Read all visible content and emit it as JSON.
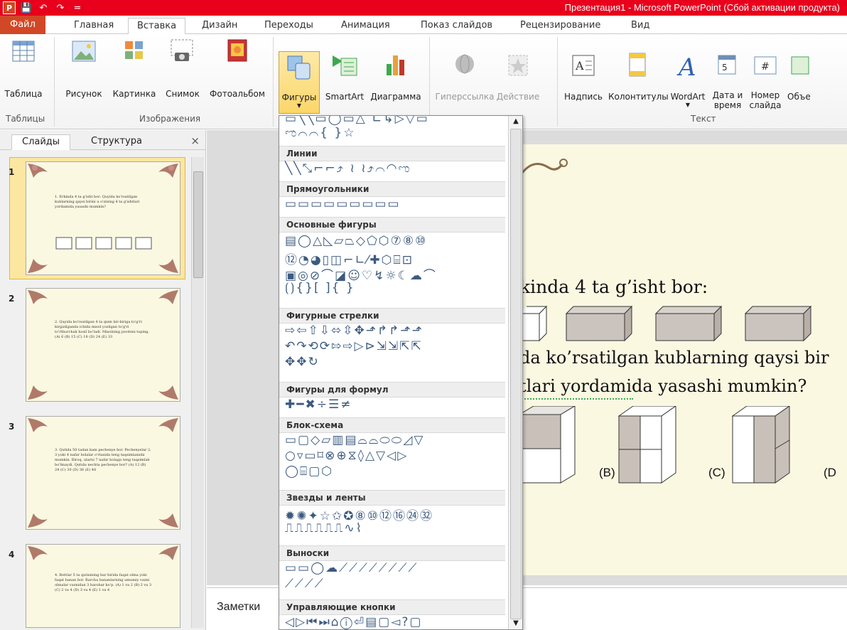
{
  "window": {
    "title": "Презентация1 - Microsoft PowerPoint (Сбой активации продукта)"
  },
  "quick_access": [
    "P",
    "💾",
    "↶",
    "↷",
    "="
  ],
  "tabs": [
    {
      "label": "Файл"
    },
    {
      "label": "Главная"
    },
    {
      "label": "Вставка"
    },
    {
      "label": "Дизайн"
    },
    {
      "label": "Переходы"
    },
    {
      "label": "Анимация"
    },
    {
      "label": "Показ слайдов"
    },
    {
      "label": "Рецензирование"
    },
    {
      "label": "Вид"
    }
  ],
  "ribbon": {
    "table": "Таблица",
    "group_tables": "Таблицы",
    "picture": "Рисунок",
    "clipart": "Картинка",
    "screenshot": "Снимок",
    "album": "Фотоальбом",
    "group_images": "Изображения",
    "shapes": "Фигуры",
    "smartart": "SmartArt",
    "chart": "Диаграмма",
    "hyperlink": "Гиперссылка",
    "action": "Действие",
    "textbox": "Надпись",
    "header": "Колонтитулы",
    "wordart": "WordArt",
    "datetime1": "Дата и",
    "datetime2": "время",
    "slidenum1": "Номер",
    "slidenum2": "слайда",
    "object": "Объе",
    "group_text": "Текст"
  },
  "pane": {
    "tab_slides": "Слайды",
    "tab_outline": "Структура",
    "close": "×"
  },
  "thumbnails": [
    {
      "num": "1",
      "text": "1. Erkinda 4 ta g'isht bor: Quyida ko'rsatilgan kublarning qaysi birini u o'zining 4 ta g'ishtlari yordamida yasashi mumkin?"
    },
    {
      "num": "2",
      "text": "2. Quyida ko'rsatilgan 4 ta qism bir-biriga to'g'ri kirgizilganda ichida misol yozilgan to'g'ri to'rtburchak hosil bo'ladi. Misolning javobini toping. (A) 6  (B) 15  (C) 18  (D) 24  (E) 33"
    },
    {
      "num": "3",
      "text": "3. Qutida 50 tadan kam pechenye bor. Pechenyelar 2, 3 yoki 4 nafar bolalar o'rtasida teng taqsimlanishi mumkin. Biroq, ularni 7 nafar bolaga teng taqsimlab bo'lmaydi. Qutida nechta pechenye bor? (A) 12  (B) 24  (C) 30  (D) 36  (E) 48"
    },
    {
      "num": "4",
      "text": "4. Bottlar 5 ta qutisining har birida faqat olma yoki faqat banan bor. Barcha bananlarning umumiy vazni olmalar vaznidan 3 barobar ko'p. (A) 1 va 2  (B) 2 va 3  (C) 2 va 4  (D) 3 va 4  (E) 1 va 4"
    }
  ],
  "slide": {
    "line1": "kinda 4 ta g’isht bor:",
    "line2": "da ko’rsatilgan kublarning qaysi bir",
    "line3": "tlari yordamida yasashi mumkin?",
    "opt_b": "(B)",
    "opt_c": "(C)",
    "opt_d": "(D"
  },
  "notes": {
    "label": "Заметки"
  },
  "shapes_menu": {
    "top_row1": "▭╲╲▭◯▭△ ∟↳▷▽▭",
    "top_row2": "ಌ⌒⌒{ }☆",
    "sections": [
      {
        "title": "Линии",
        "rows": [
          "╲╲⤡⌐⌐⤴ ≀ ≀⤴⌒◠ಌ"
        ]
      },
      {
        "title": "Прямоугольники",
        "rows": [
          "▭▭▭▭▭▭▭▭▭"
        ]
      },
      {
        "title": "Основные фигуры",
        "rows": [
          "▤◯△◺▱⏢◇⬠⬡⑦⑧⑩",
          "⑫◔◕▯◫⌐∟⁄✚⬡⌸⊡",
          "▣◎⊘⌒◪☺♡↯☼☾☁⌒",
          "⟮⟯{}[ ]{ }"
        ]
      },
      {
        "title": "Фигурные стрелки",
        "rows": [
          "⇨⇦⇧⇩⬄⇳✥⬏↱↱⬏⬏",
          "↶↷⟲⟳⇰⇨▷⊳⇲⇲⇱⇱",
          "✥✥↻"
        ]
      },
      {
        "title": "Фигуры для формул",
        "rows": [
          "✚━✖÷☰≠"
        ]
      },
      {
        "title": "Блок-схема",
        "rows": [
          "▭▢◇▱▥▤⌓⌓⬭⬭◿▽",
          "○▿▭⌑⊗⊕⧖◊△▽◁▷",
          "◯⌸▢⬡"
        ]
      },
      {
        "title": "Звезды и ленты",
        "rows": [
          "✹✺✦☆✩✪⑧⑩⑫⑯㉔㉜",
          "⎍⎍⎍⎍⎍⎍∿⌇"
        ]
      },
      {
        "title": "Выноски",
        "rows": [
          "▭▭◯☁⟋⟋⟋⟋⟋⟋⟋⟋",
          "⟋⟋⟋⟋"
        ]
      },
      {
        "title": "Управляющие кнопки",
        "rows": [
          "◁▷⏮⏭⌂ⓘ⏎▤▢◅?▢"
        ]
      }
    ]
  }
}
